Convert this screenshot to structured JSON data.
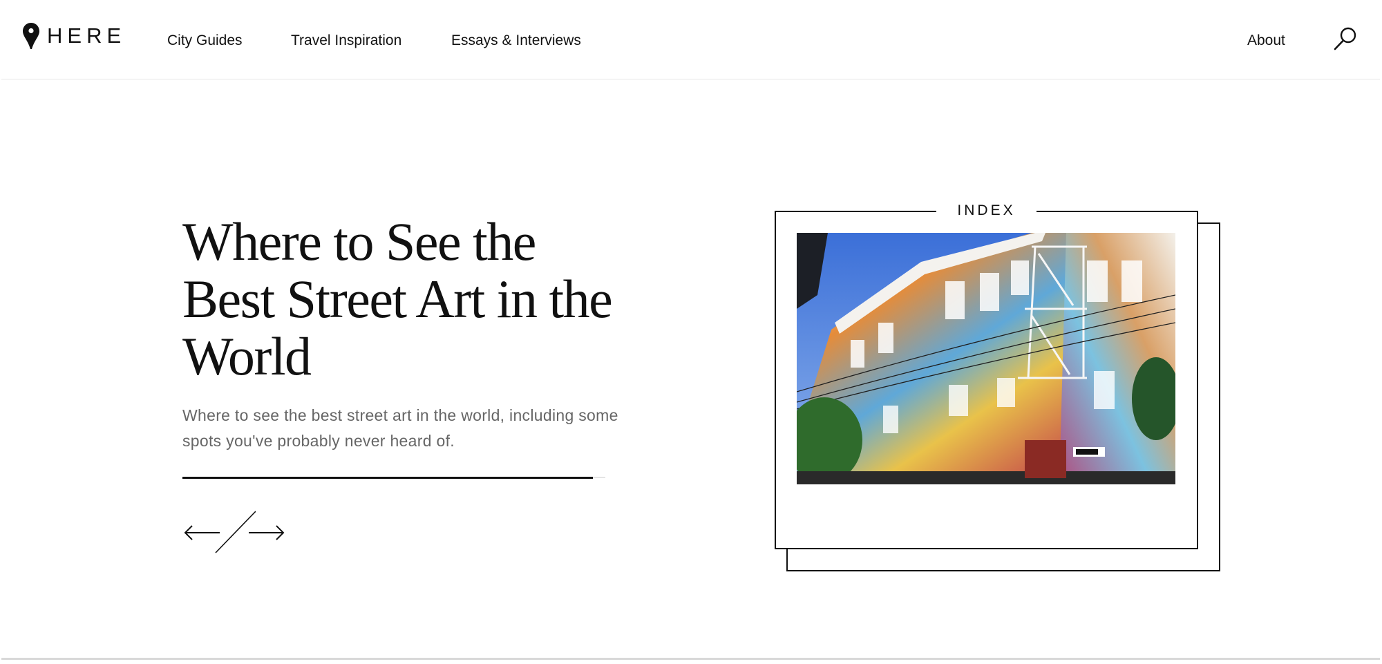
{
  "header": {
    "logo_text": "HERE",
    "nav": [
      {
        "label": "City Guides"
      },
      {
        "label": "Travel Inspiration"
      },
      {
        "label": "Essays & Interviews"
      }
    ],
    "about_label": "About"
  },
  "hero": {
    "title": "Where to See the Best Street Art in the World",
    "subtitle": "Where to see the best street art in the world, including some spots you've probably never heard of.",
    "progress": 0.97
  },
  "card": {
    "label": "INDEX"
  },
  "icons": {
    "logo": "map-pin-icon",
    "search": "search-icon",
    "prev": "arrow-left-icon",
    "next": "arrow-right-icon"
  },
  "colors": {
    "text": "#111111",
    "subtitle": "#666666",
    "divider": "#e6e6e6"
  }
}
